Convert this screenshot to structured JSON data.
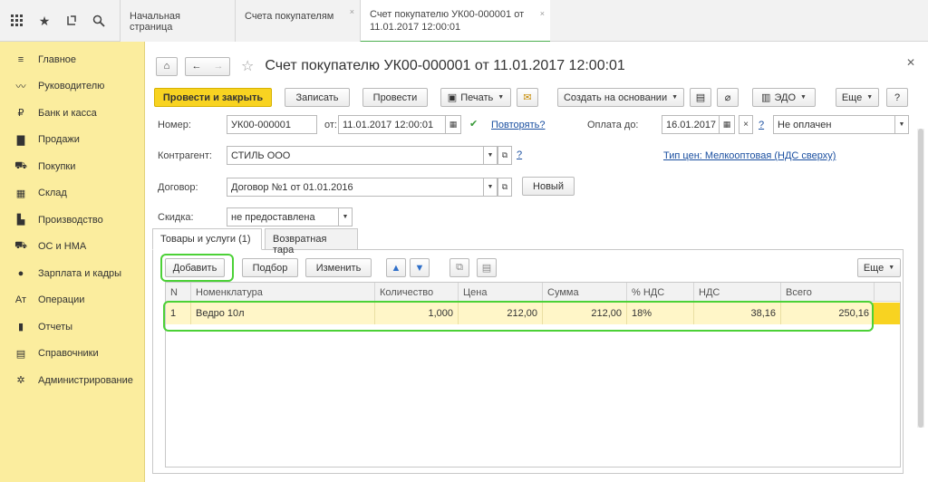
{
  "top_icons": [
    "apps-grid-icon",
    "star-icon",
    "history-icon",
    "search-icon"
  ],
  "tabs": [
    {
      "label": "Начальная страница"
    },
    {
      "label": "Счета покупателям",
      "close": "×"
    },
    {
      "label_line1": "Счет покупателю УК00-000001 от",
      "label_line2": "11.01.2017 12:00:01",
      "close": "×"
    }
  ],
  "sidebar": {
    "items": [
      {
        "label": "Главное",
        "icon": "menu-icon",
        "glyph": "≡"
      },
      {
        "label": "Руководителю",
        "icon": "chart-line-icon",
        "glyph": "〰"
      },
      {
        "label": "Банк и касса",
        "icon": "bank-icon",
        "glyph": "₽"
      },
      {
        "label": "Продажи",
        "icon": "bag-icon",
        "glyph": "▇"
      },
      {
        "label": "Покупки",
        "icon": "cart-icon",
        "glyph": "⛟"
      },
      {
        "label": "Склад",
        "icon": "warehouse-icon",
        "glyph": "▦"
      },
      {
        "label": "Производство",
        "icon": "factory-icon",
        "glyph": "▙"
      },
      {
        "label": "ОС и НМА",
        "icon": "truck-icon",
        "glyph": "⛟"
      },
      {
        "label": "Зарплата и кадры",
        "icon": "person-icon",
        "glyph": "●"
      },
      {
        "label": "Операции",
        "icon": "operations-icon",
        "glyph": "Ат"
      },
      {
        "label": "Отчеты",
        "icon": "bar-chart-icon",
        "glyph": "▮"
      },
      {
        "label": "Справочники",
        "icon": "book-icon",
        "glyph": "▤"
      },
      {
        "label": "Администрирование",
        "icon": "gear-icon",
        "glyph": "✲"
      }
    ]
  },
  "title": "Счет покупателю УК00-000001 от 11.01.2017 12:00:01",
  "toolbar": {
    "post_close": "Провести и закрыть",
    "save": "Записать",
    "post": "Провести",
    "print": "Печать",
    "create_based": "Создать на основании",
    "edo": "ЭДО",
    "more": "Еще",
    "help": "?"
  },
  "form": {
    "number_label": "Номер:",
    "number_value": "УК00-000001",
    "from_label": "от:",
    "date_value": "11.01.2017 12:00:01",
    "repeat_link": "Повторять?",
    "payment_label": "Оплата до:",
    "payment_date": "16.01.2017",
    "payment_status": "Не оплачен",
    "question": "?",
    "contractor_label": "Контрагент:",
    "contractor_value": "СТИЛЬ ООО",
    "price_type_link": "Тип цен: Мелкооптовая (НДС сверху)",
    "contract_label": "Договор:",
    "contract_value": "Договор №1 от 01.01.2016",
    "new_button": "Новый",
    "discount_label": "Скидка:",
    "discount_value": "не предоставлена"
  },
  "inner_tabs": [
    "Товары и услуги (1)",
    "Возвратная тара"
  ],
  "table_toolbar": {
    "add": "Добавить",
    "select": "Подбор",
    "edit": "Изменить",
    "more": "Еще"
  },
  "table": {
    "columns": [
      "N",
      "Номенклатура",
      "Количество",
      "Цена",
      "Сумма",
      "% НДС",
      "НДС",
      "Всего"
    ],
    "rows": [
      [
        "1",
        "Ведро 10л",
        "1,000",
        "212,00",
        "212,00",
        "18%",
        "38,16",
        "250,16"
      ]
    ]
  }
}
